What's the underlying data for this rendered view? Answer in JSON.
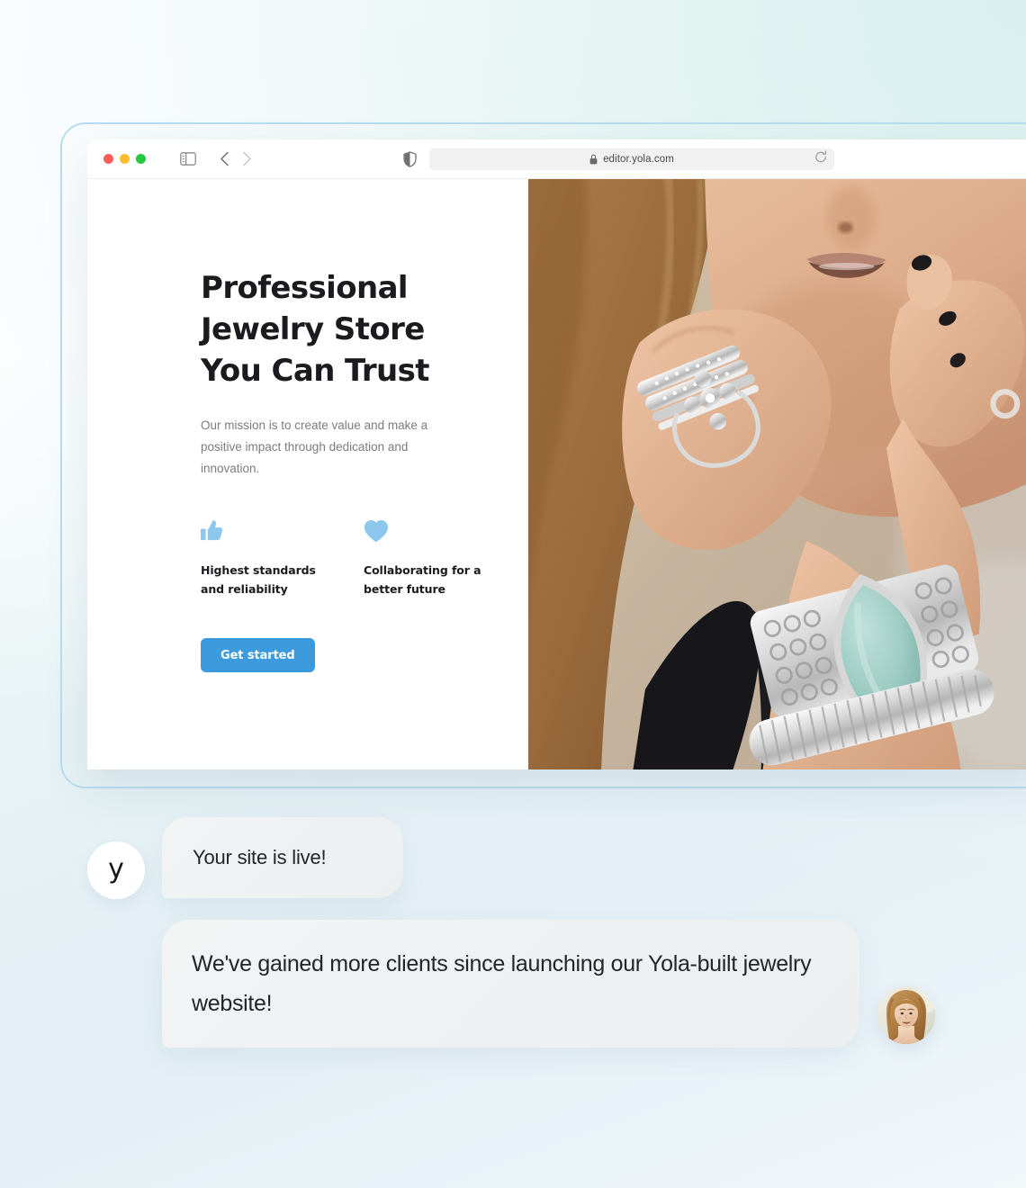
{
  "background": {
    "accent_mint": "#e3f2f0",
    "accent_blue": "#e3eff5"
  },
  "browser": {
    "traffic_lights": [
      {
        "name": "close",
        "color": "#ff5f57"
      },
      {
        "name": "minimize",
        "color": "#febc2e"
      },
      {
        "name": "fullscreen",
        "color": "#28c840"
      }
    ],
    "sidebar_toggle_icon": "sidebar-icon",
    "back_icon": "chevron-left-icon",
    "forward_icon": "chevron-right-icon",
    "shield_icon": "shield-icon",
    "lock_icon": "lock-icon",
    "reload_icon": "reload-icon",
    "url": "editor.yola.com"
  },
  "hero": {
    "title": "Professional Jewelry Store You Can Trust",
    "subtitle": "Our mission is to create value and make a positive impact through dedication and innovation.",
    "features": [
      {
        "icon": "thumbs-up-icon",
        "label": "Highest standards and reliability",
        "color": "#8ec7ee"
      },
      {
        "icon": "heart-icon",
        "label": "Collaborating for a better future",
        "color": "#8ec7ee"
      }
    ],
    "cta_label": "Get started",
    "cta_color": "#3b9bdc",
    "photo_alt": "Close-up of a woman resting her chin on her hands wearing diamond rings and a silver bracelet with a large turquoise stone"
  },
  "chat": {
    "brand_initial": "y",
    "messages": [
      {
        "sender": "yola",
        "text": "Your site is live!"
      },
      {
        "sender": "customer",
        "text": "We've gained more clients since launching our Yola-built jewelry website!"
      }
    ],
    "customer_avatar_alt": "Smiling woman with long light-brown hair"
  }
}
